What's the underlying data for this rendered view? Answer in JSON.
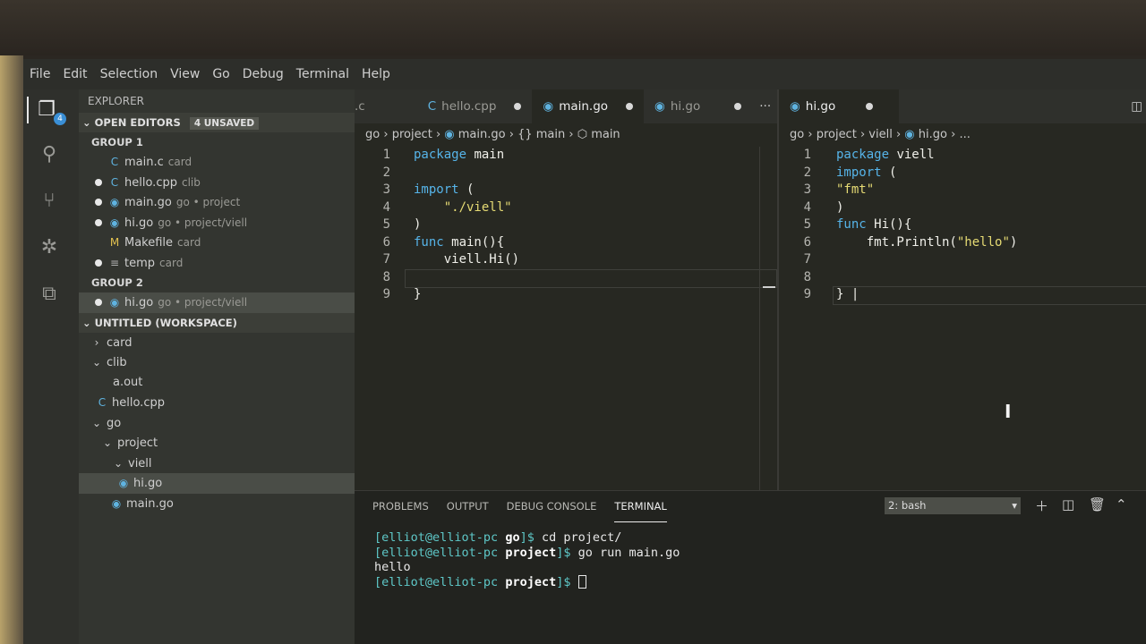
{
  "menu": [
    "File",
    "Edit",
    "Selection",
    "View",
    "Go",
    "Debug",
    "Terminal",
    "Help"
  ],
  "activity": {
    "explorer_badge": "4"
  },
  "sidebar": {
    "title": "EXPLORER",
    "open_editors": {
      "label": "OPEN EDITORS",
      "unsaved": "4 UNSAVED"
    },
    "group1": {
      "label": "GROUP 1",
      "items": [
        {
          "name": "main.c",
          "desc": "card"
        },
        {
          "name": "hello.cpp",
          "desc": "clib"
        },
        {
          "name": "main.go",
          "desc": "go • project"
        },
        {
          "name": "hi.go",
          "desc": "go • project/viell"
        },
        {
          "name": "Makefile",
          "desc": "card"
        },
        {
          "name": "temp",
          "desc": "card"
        }
      ]
    },
    "group2": {
      "label": "GROUP 2",
      "items": [
        {
          "name": "hi.go",
          "desc": "go • project/viell"
        }
      ]
    },
    "workspace": {
      "label": "UNTITLED (WORKSPACE)",
      "items": [
        "card",
        "clib",
        "a.out",
        "hello.cpp",
        "go",
        "project",
        "viell",
        "hi.go",
        "main.go"
      ]
    }
  },
  "editor1": {
    "tabs": [
      ".c",
      "hello.cpp",
      "main.go",
      "hi.go"
    ],
    "breadcrumb": [
      "go",
      "project",
      "main.go",
      "{} main",
      "main"
    ],
    "lines": [
      "1",
      "2",
      "3",
      "4",
      "5",
      "6",
      "7",
      "8",
      "9"
    ],
    "code": {
      "l1_kw": "package",
      "l1_rest": " main",
      "l3_kw": "import",
      "l3_rest": " (",
      "l4_str": "\"./viell\"",
      "l5": ")",
      "l6_kw": "func",
      "l6_rest": " main(){",
      "l7": "viell.Hi()",
      "l9": "}"
    }
  },
  "editor2": {
    "tabs": [
      "hi.go"
    ],
    "breadcrumb": [
      "go",
      "project",
      "viell",
      "hi.go",
      "..."
    ],
    "lines": [
      "1",
      "2",
      "3",
      "4",
      "5",
      "6",
      "7",
      "8",
      "9"
    ],
    "code": {
      "l1_kw": "package",
      "l1_rest": " viell",
      "l2_kw": "import",
      "l2_rest": " (",
      "l3_str": "\"fmt\"",
      "l4": ")",
      "l5_kw": "func",
      "l5_rest": " Hi(){",
      "l6_a": "fmt.Println(",
      "l6_str": "\"hello\"",
      "l6_b": ")",
      "l9": "}"
    }
  },
  "panel": {
    "tabs": [
      "PROBLEMS",
      "OUTPUT",
      "DEBUG CONSOLE",
      "TERMINAL"
    ],
    "terminal_select": "2: bash",
    "terminal": [
      {
        "prompt": "[elliot@elliot-pc ",
        "cwd": "go",
        "end": "]$ ",
        "cmd": "cd project/"
      },
      {
        "prompt": "[elliot@elliot-pc ",
        "cwd": "project",
        "end": "]$ ",
        "cmd": "go run main.go"
      },
      {
        "output": "hello"
      },
      {
        "prompt": "[elliot@elliot-pc ",
        "cwd": "project",
        "end": "]$ ",
        "cmd": ""
      }
    ]
  },
  "colors": {
    "keyword": "#56b4e9",
    "string": "#e6db74",
    "go_icon": "#5fb3e0",
    "make_icon": "#e2c14f"
  },
  "icons": [
    "files-icon",
    "search-icon",
    "source-control-icon",
    "debug-icon",
    "extensions-icon",
    "split-editor-icon",
    "plus-icon",
    "trash-icon",
    "maximize-icon"
  ]
}
